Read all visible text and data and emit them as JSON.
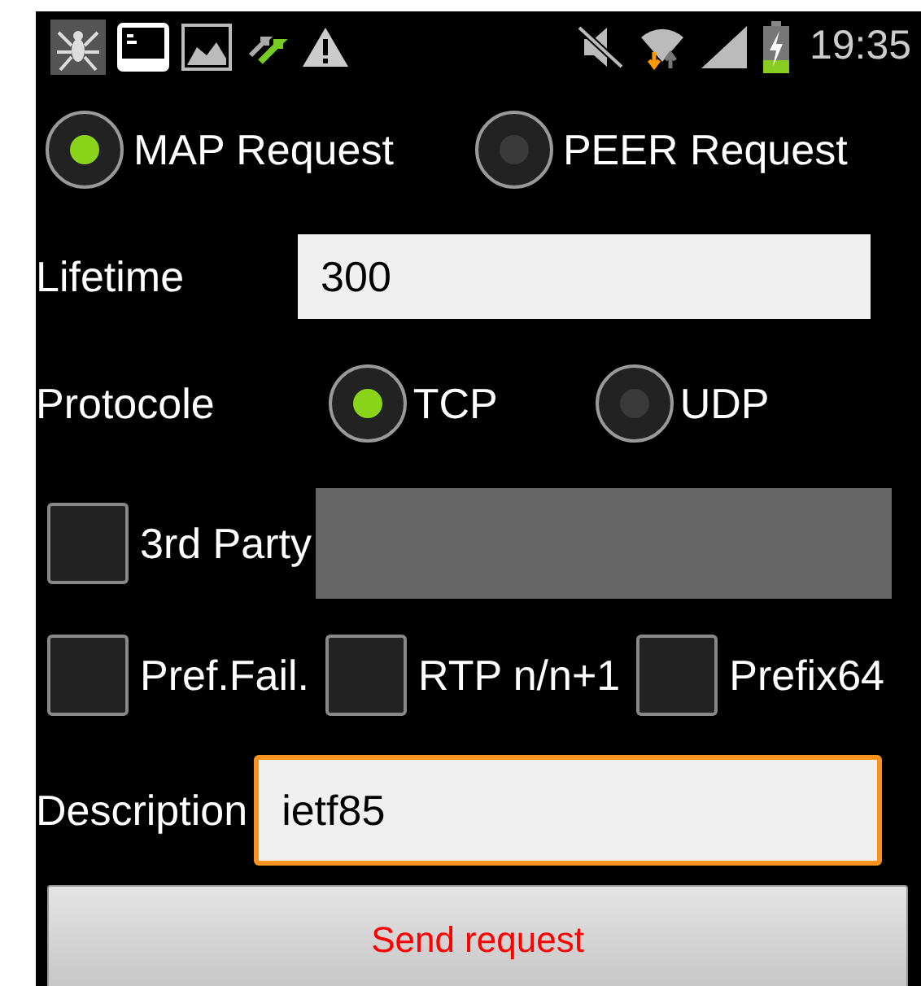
{
  "status_bar": {
    "time": "19:35"
  },
  "request_type": [
    {
      "label": "MAP Request",
      "selected": true
    },
    {
      "label": "PEER Request",
      "selected": false
    }
  ],
  "lifetime": {
    "label": "Lifetime",
    "value": "300"
  },
  "protocol": {
    "label": "Protocole",
    "options": [
      {
        "label": "TCP",
        "selected": true
      },
      {
        "label": "UDP",
        "selected": false
      }
    ]
  },
  "third_party": {
    "label": "3rd Party",
    "checked": false,
    "field_disabled": true
  },
  "options": [
    {
      "label": "Pref.Fail.",
      "checked": false
    },
    {
      "label": "RTP n/n+1",
      "checked": false
    },
    {
      "label": "Prefix64",
      "checked": false
    }
  ],
  "description": {
    "label": "Description",
    "value": "ietf85",
    "focused": true
  },
  "send_button": "Send request"
}
